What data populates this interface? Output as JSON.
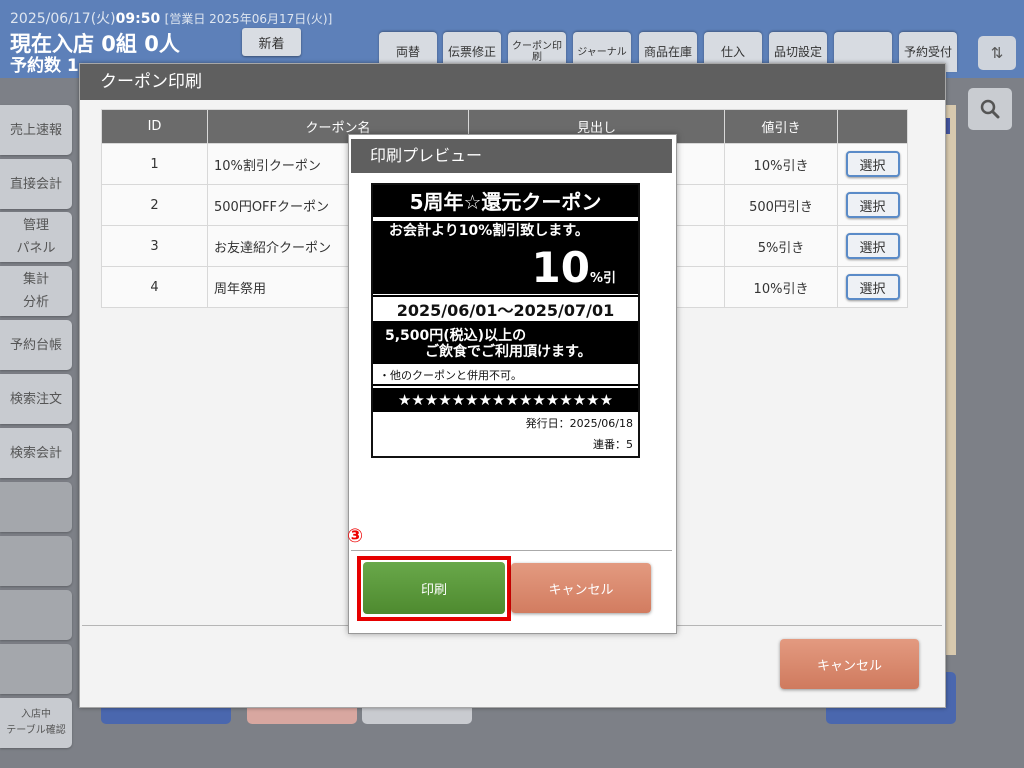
{
  "header": {
    "date": "2025/06/17(火)",
    "time": "09:50",
    "business_day": "[営業日 2025年06月17日(火)]",
    "current_count": "現在入店 0組 0人",
    "reservation_count": "予約数 1"
  },
  "top_buttons": {
    "new_arrival": "新着",
    "exchange": "両替",
    "slip_edit": "伝票修正",
    "coupon_print": "クーポン印刷",
    "journal": "ジャーナル",
    "product_stock": "商品在庫",
    "purchase": "仕入",
    "sold_out": "品切設定",
    "blank": "",
    "reservation": "予約受付"
  },
  "sidebar": {
    "items": [
      {
        "label": "売上速報"
      },
      {
        "label": "直接会計"
      },
      {
        "label": "管理\nパネル"
      },
      {
        "label": "集計\n分析"
      },
      {
        "label": "予約台帳"
      },
      {
        "label": "検索注文"
      },
      {
        "label": "検索会計"
      },
      {
        "label": ""
      },
      {
        "label": ""
      },
      {
        "label": ""
      },
      {
        "label": ""
      },
      {
        "label": "入店中\nテーブル確認"
      }
    ]
  },
  "coupon_dialog": {
    "title": "クーポン印刷",
    "columns": [
      "ID",
      "クーポン名",
      "見出し",
      "値引き",
      ""
    ],
    "rows": [
      {
        "id": "1",
        "name": "10%割引クーポン",
        "discount": "10%引き",
        "select": "選択"
      },
      {
        "id": "2",
        "name": "500円OFFクーポン",
        "discount": "500円引き",
        "select": "選択"
      },
      {
        "id": "3",
        "name": "お友達紹介クーポン",
        "discount": "5%引き",
        "select": "選択"
      },
      {
        "id": "4",
        "name": "周年祭用",
        "discount": "10%引き",
        "select": "選択"
      }
    ],
    "cancel_label": "キャンセル"
  },
  "preview_dialog": {
    "title": "印刷プレビュー",
    "ticket": {
      "title": "5周年☆還元クーポン",
      "description": "お会計より10%割引致します。",
      "amount": "10",
      "amount_unit": "%引",
      "period": "2025/06/01～2025/07/01",
      "condition_line1": "5,500円(税込)以上の",
      "condition_line2": "ご飲食でご利用頂けます。",
      "note": "・他のクーポンと併用不可。",
      "stars": "★★★★★★★★★★★★★★★★",
      "issue_date": "発行日：2025/06/18",
      "serial": "連番：5"
    },
    "step_badge": "③",
    "print_label": "印刷",
    "cancel_label": "キャンセル"
  },
  "colors": {
    "top_bar": "#5d80b9",
    "dialog_header": "#5f5f5f",
    "print_button": "#5a9a3c",
    "cancel_button": "#dd8c6f",
    "highlight": "#e60000"
  }
}
